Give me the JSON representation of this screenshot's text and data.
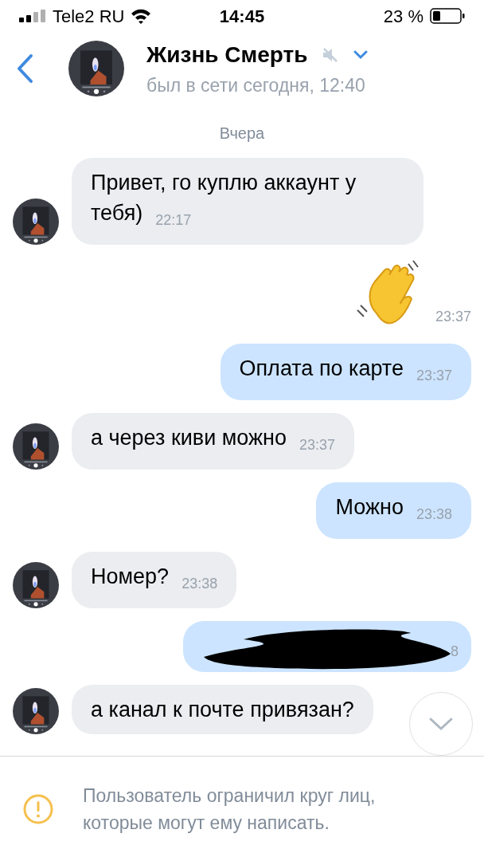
{
  "status_bar": {
    "carrier": "Tele2 RU",
    "time": "14:45",
    "battery": "23 %"
  },
  "header": {
    "name": "Жизнь Смерть",
    "muted": true,
    "status": "был в сети сегодня, 12:40"
  },
  "date_separator": "Вчера",
  "messages": [
    {
      "kind": "text",
      "outgoing": false,
      "text": "Привет, го куплю аккаунт у тебя)",
      "time": "22:17"
    },
    {
      "kind": "sticker",
      "outgoing": true,
      "time": "23:37"
    },
    {
      "kind": "text",
      "outgoing": true,
      "text": "Оплата по карте",
      "time": "23:37"
    },
    {
      "kind": "text",
      "outgoing": false,
      "text": "а через киви можно",
      "time": "23:37"
    },
    {
      "kind": "text",
      "outgoing": true,
      "text": "Можно",
      "time": "23:38"
    },
    {
      "kind": "text",
      "outgoing": false,
      "text": "Номер?",
      "time": "23:38"
    },
    {
      "kind": "redacted",
      "outgoing": true,
      "time": "8"
    },
    {
      "kind": "text",
      "outgoing": false,
      "text": "а канал к почте привязан?"
    }
  ],
  "notice": "Пользователь ограничил круг лиц,\nкоторые могут ему написать."
}
